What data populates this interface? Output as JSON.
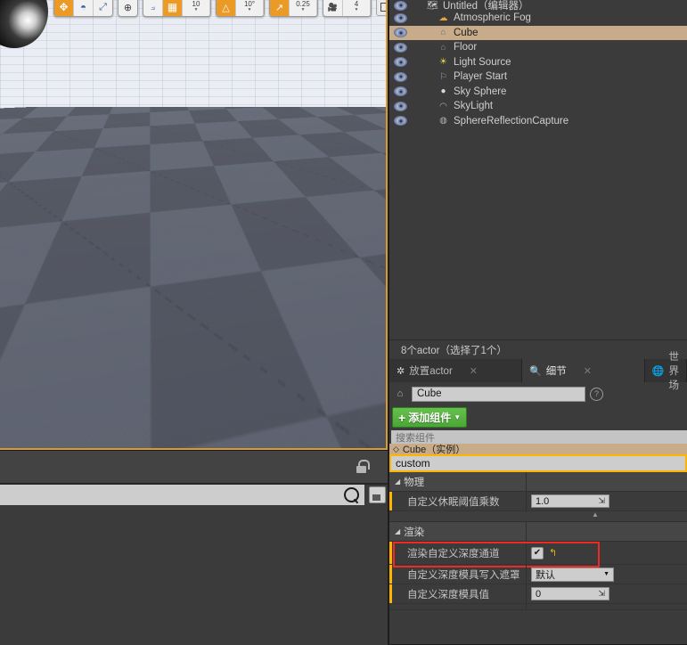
{
  "viewport": {
    "toolbar": {
      "groups": [
        {
          "name": "transform-modes",
          "buttons": [
            {
              "icon": "move-gizmo-icon",
              "active": true
            },
            {
              "icon": "rotate-gizmo-icon",
              "active": false
            },
            {
              "icon": "scale-gizmo-icon",
              "active": false
            }
          ]
        },
        {
          "name": "coordinate-system",
          "buttons": [
            {
              "icon": "world-space-icon",
              "active": false
            }
          ]
        },
        {
          "name": "surface-snap",
          "buttons": [
            {
              "icon": "surface-snap-icon",
              "active": false
            },
            {
              "icon": "grid-snap-icon",
              "active": true
            }
          ],
          "value": "10"
        },
        {
          "name": "angle-snap",
          "buttons": [
            {
              "icon": "angle-snap-icon",
              "active": true
            }
          ],
          "value": "10°"
        },
        {
          "name": "scale-snap",
          "buttons": [
            {
              "icon": "scale-snap-icon",
              "active": true
            }
          ],
          "value": "0.25"
        },
        {
          "name": "camera-speed",
          "buttons": [
            {
              "icon": "camera-icon",
              "active": false
            }
          ],
          "value": "4"
        }
      ],
      "maximize_label": "□"
    },
    "selected_actor_outline_color": "#ffbe0b",
    "selected_actor_color": "#ad6178"
  },
  "content_browser": {
    "lock_icon": "lock-open-icon",
    "search_placeholder": "",
    "search_value": "",
    "search_icon": "search-icon",
    "save_icon": "save-icon"
  },
  "outliner": {
    "rows": [
      {
        "label": "Untitled（编辑器）",
        "icon": "world-icon",
        "indent": 0,
        "selected": false,
        "eye": true,
        "partial": true
      },
      {
        "label": "Atmospheric Fog",
        "icon": "fog-icon",
        "indent": 1,
        "selected": false,
        "eye": true
      },
      {
        "label": "Cube",
        "icon": "static-mesh-icon",
        "indent": 1,
        "selected": true,
        "eye": true
      },
      {
        "label": "Floor",
        "icon": "static-mesh-icon",
        "indent": 1,
        "selected": false,
        "eye": true
      },
      {
        "label": "Light Source",
        "icon": "directional-light-icon",
        "indent": 1,
        "selected": false,
        "eye": true
      },
      {
        "label": "Player Start",
        "icon": "player-start-icon",
        "indent": 1,
        "selected": false,
        "eye": true
      },
      {
        "label": "Sky Sphere",
        "icon": "sphere-icon",
        "indent": 1,
        "selected": false,
        "eye": true
      },
      {
        "label": "SkyLight",
        "icon": "sky-light-icon",
        "indent": 1,
        "selected": false,
        "eye": true
      },
      {
        "label": "SphereReflectionCapture",
        "icon": "reflection-capture-icon",
        "indent": 1,
        "selected": false,
        "eye": true
      }
    ],
    "status": "8个actor（选择了1个）"
  },
  "details": {
    "tabs": [
      {
        "label": "放置actor",
        "icon": "place-actors-icon",
        "active": false,
        "closable": true
      },
      {
        "label": "细节",
        "icon": "details-icon",
        "active": true,
        "closable": true
      },
      {
        "label": "世界场",
        "icon": "world-settings-icon",
        "active": false,
        "closable": false
      }
    ],
    "actor_name": "Cube",
    "help_icon": "help-icon",
    "add_component_button": "添加组件",
    "component_search_placeholder": "搜索组件",
    "component_row": "Cube（实例）",
    "property_search_value": "custom",
    "sections": [
      {
        "title": "物理",
        "rows": [
          {
            "label": "自定义休眠阈值乘数",
            "type": "number",
            "value": "1.0"
          }
        ],
        "has_collapse_arrow": true
      },
      {
        "title": "渲染",
        "rows": [
          {
            "label": "渲染自定义深度通道",
            "type": "checkbox",
            "value": "checked",
            "reset_icon": "reset-to-default-icon",
            "highlighted": true
          },
          {
            "label": "自定义深度模具写入遮罩",
            "type": "dropdown",
            "value": "默认"
          },
          {
            "label": "自定义深度模具值",
            "type": "number",
            "value": "0"
          }
        ],
        "has_collapse_arrow": false
      }
    ],
    "highlight_box_color": "#ee2a22",
    "search_highlight_color": "#ffb400"
  }
}
